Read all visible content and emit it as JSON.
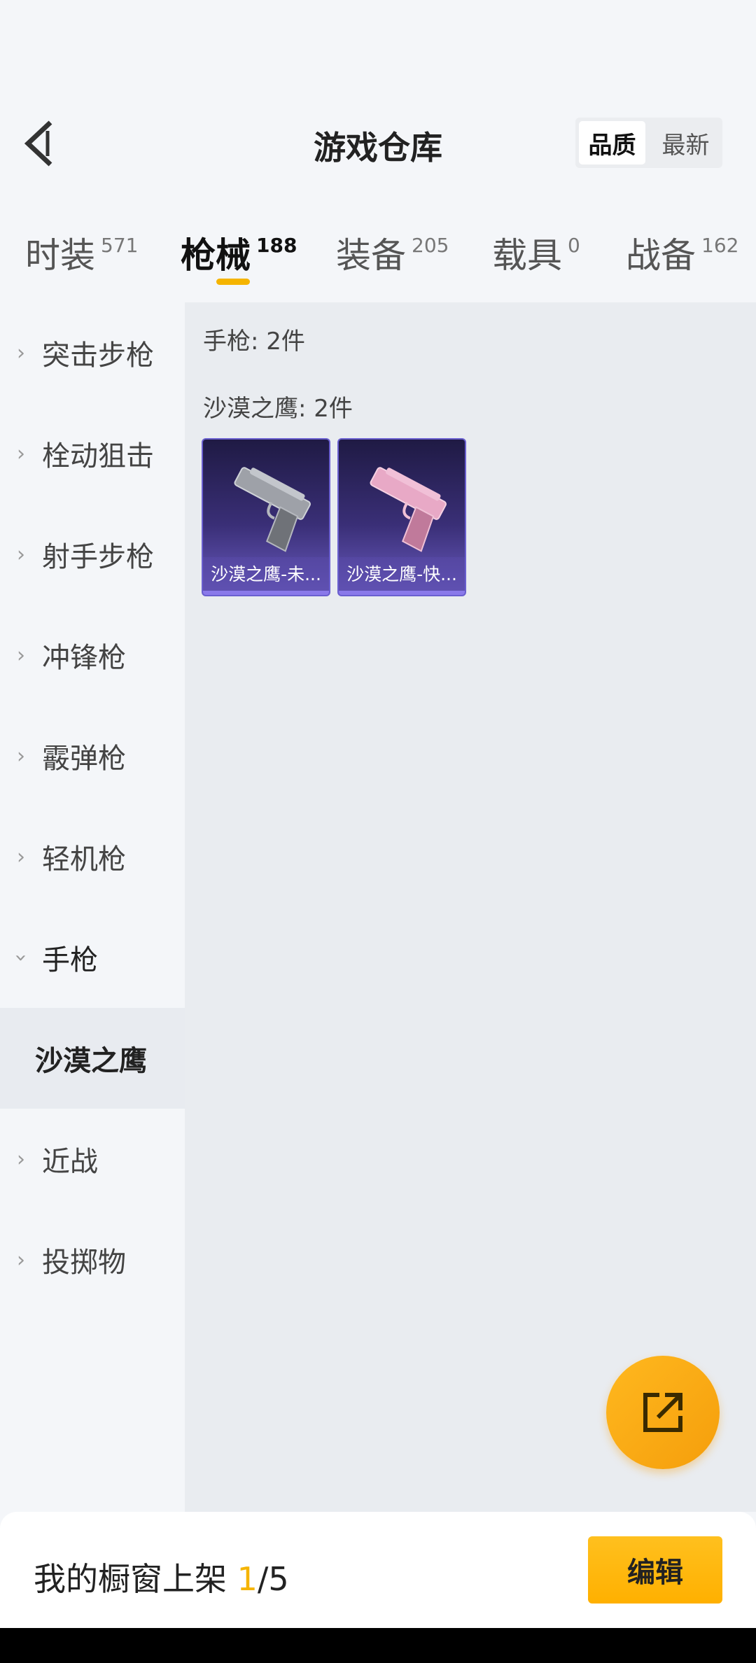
{
  "header": {
    "title": "游戏仓库",
    "back_icon": "chevron-left-icon",
    "sort_options": [
      "品质",
      "最新"
    ],
    "sort_selected": "品质"
  },
  "tabs": [
    {
      "label": "时装",
      "count": "571"
    },
    {
      "label": "枪械",
      "count": "188",
      "active": true
    },
    {
      "label": "装备",
      "count": "205"
    },
    {
      "label": "载具",
      "count": "0"
    },
    {
      "label": "战备",
      "count": "162"
    }
  ],
  "sidebar": {
    "items": [
      {
        "label": "突击步枪"
      },
      {
        "label": "栓动狙击"
      },
      {
        "label": "射手步枪"
      },
      {
        "label": "冲锋枪"
      },
      {
        "label": "霰弹枪"
      },
      {
        "label": "轻机枪"
      },
      {
        "label": "手枪",
        "expanded": true
      },
      {
        "label": "近战"
      },
      {
        "label": "投掷物"
      }
    ],
    "sub_selected": "沙漠之鹰"
  },
  "content": {
    "category_summary": "手枪: 2件",
    "group_label": "沙漠之鹰: 2件",
    "items": [
      {
        "name": "沙漠之鹰-未...",
        "gun_color": "#9ea1a8"
      },
      {
        "name": "沙漠之鹰-快...",
        "gun_color": "#e8a9c6"
      }
    ]
  },
  "fab": {
    "icon": "share-external-icon",
    "color": "#f5a814"
  },
  "bottom": {
    "shelf_label": "我的橱窗上架",
    "shelf_count": "1",
    "shelf_total": "/5",
    "edit_label": "编辑"
  },
  "colors": {
    "accent": "#f5b400",
    "card_bg": "#3a2f77"
  }
}
